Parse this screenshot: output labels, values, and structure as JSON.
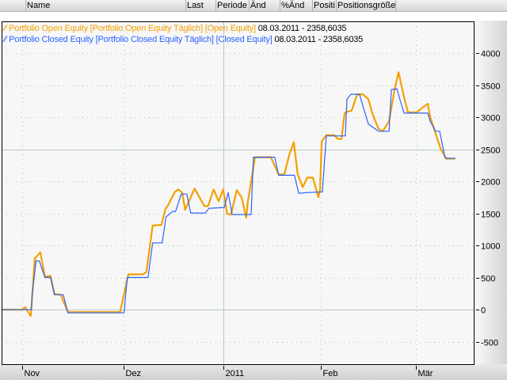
{
  "header": {
    "columns": [
      "Name",
      "Last",
      "Periode",
      "Änd",
      "%Änd",
      "Positi",
      "Positionsgröße"
    ]
  },
  "legend": [
    {
      "label": "Portfolio Open Equity [Portfolio Open Equity  Täglich] [Open Equity]",
      "value": "08.03.2011 - 2358,6035",
      "color": "#f5a000",
      "icon": "line-series-icon"
    },
    {
      "label": "Portfolio Closed Equity [Portfolio Closed Equity  Täglich] [Closed Equity]",
      "value": "08.03.2011 - 2358,6035",
      "color": "#2b63ff",
      "icon": "line-series-icon"
    }
  ],
  "chart_data": {
    "type": "line",
    "xlabel": "",
    "ylabel": "",
    "ylim": [
      -850,
      4500
    ],
    "xlim": [
      -6.2,
      137.6
    ],
    "x_unit": "days since 1 Nov 2010",
    "x_ticks": [
      {
        "label": "Nov",
        "x": 0
      },
      {
        "label": "Dez",
        "x": 31
      },
      {
        "label": "2011",
        "x": 61.3,
        "major": true
      },
      {
        "label": "Feb",
        "x": 91
      },
      {
        "label": "Mär",
        "x": 120
      }
    ],
    "y_ticks": [
      -500,
      0,
      500,
      1000,
      1500,
      2000,
      2500,
      3000,
      3500,
      4000
    ],
    "y_major": [
      0,
      2500
    ],
    "series": [
      {
        "name": "Portfolio Open Equity",
        "color": "#f5a000",
        "points": [
          [
            -6,
            0
          ],
          [
            0,
            0
          ],
          [
            1,
            37
          ],
          [
            1.9,
            -37
          ],
          [
            2.7,
            -98
          ],
          [
            3.9,
            798
          ],
          [
            5.6,
            896
          ],
          [
            7,
            515
          ],
          [
            8.7,
            528
          ],
          [
            9.9,
            245
          ],
          [
            11.8,
            233
          ],
          [
            13.5,
            25
          ],
          [
            14,
            -37
          ],
          [
            29.9,
            -37
          ],
          [
            32.4,
            552
          ],
          [
            36.9,
            552
          ],
          [
            37.9,
            590
          ],
          [
            39.8,
            1313
          ],
          [
            42.5,
            1325
          ],
          [
            43.7,
            1571
          ],
          [
            44.4,
            1620
          ],
          [
            46.6,
            1840
          ],
          [
            47.6,
            1877
          ],
          [
            48.8,
            1828
          ],
          [
            49.7,
            1558
          ],
          [
            52.6,
            1890
          ],
          [
            55.5,
            1620
          ],
          [
            56.7,
            1620
          ],
          [
            58.4,
            1877
          ],
          [
            59.9,
            1693
          ],
          [
            61.3,
            1877
          ],
          [
            62.5,
            1497
          ],
          [
            63.7,
            1485
          ],
          [
            65.4,
            1865
          ],
          [
            66.9,
            1755
          ],
          [
            68.3,
            1436
          ],
          [
            68.8,
            1681
          ],
          [
            71,
            2380
          ],
          [
            75.8,
            2380
          ],
          [
            78.2,
            2110
          ],
          [
            79.9,
            2110
          ],
          [
            81.4,
            2417
          ],
          [
            82.8,
            2614
          ],
          [
            84,
            2110
          ],
          [
            85.5,
            1914
          ],
          [
            86.9,
            2061
          ],
          [
            88.6,
            2061
          ],
          [
            89.8,
            1840
          ],
          [
            90.3,
            1755
          ],
          [
            90.8,
            1877
          ],
          [
            91.3,
            2626
          ],
          [
            92.7,
            2724
          ],
          [
            95.1,
            2724
          ],
          [
            96.3,
            2663
          ],
          [
            97.3,
            2663
          ],
          [
            98.3,
            3068
          ],
          [
            99,
            3092
          ],
          [
            100.4,
            3104
          ],
          [
            102.1,
            3362
          ],
          [
            103.8,
            3362
          ],
          [
            105.5,
            3288
          ],
          [
            106.7,
            3068
          ],
          [
            108.6,
            2822
          ],
          [
            109.9,
            2785
          ],
          [
            111.8,
            2945
          ],
          [
            113.5,
            3436
          ],
          [
            114.7,
            3706
          ],
          [
            116.6,
            3264
          ],
          [
            117.6,
            3080
          ],
          [
            120.2,
            3080
          ],
          [
            121.7,
            3141
          ],
          [
            123.6,
            3215
          ],
          [
            124.3,
            3018
          ],
          [
            126,
            2748
          ],
          [
            127.5,
            2515
          ],
          [
            129.2,
            2356
          ],
          [
            132,
            2358.6
          ]
        ]
      },
      {
        "name": "Portfolio Closed Equity",
        "color": "#2b63ff",
        "points": [
          [
            -6,
            0
          ],
          [
            2.9,
            0
          ],
          [
            3.1,
            221
          ],
          [
            4.3,
            761
          ],
          [
            5.3,
            761
          ],
          [
            7,
            503
          ],
          [
            8.7,
            503
          ],
          [
            9.9,
            233
          ],
          [
            12.6,
            233
          ],
          [
            14,
            -49
          ],
          [
            31.1,
            -49
          ],
          [
            32.1,
            503
          ],
          [
            38.4,
            503
          ],
          [
            39.8,
            1043
          ],
          [
            42.7,
            1043
          ],
          [
            43.9,
            1448
          ],
          [
            45.9,
            1534
          ],
          [
            46.8,
            1534
          ],
          [
            48.5,
            1804
          ],
          [
            50.2,
            1804
          ],
          [
            51.4,
            1509
          ],
          [
            55.8,
            1509
          ],
          [
            57,
            1583
          ],
          [
            61.6,
            1595
          ],
          [
            62.8,
            1828
          ],
          [
            64,
            1485
          ],
          [
            69.8,
            1485
          ],
          [
            70.5,
            2380
          ],
          [
            77,
            2380
          ],
          [
            78.2,
            2098
          ],
          [
            83,
            2098
          ],
          [
            84.3,
            1816
          ],
          [
            86.7,
            1828
          ],
          [
            91.5,
            1840
          ],
          [
            92.7,
            2712
          ],
          [
            98.5,
            2712
          ],
          [
            99,
            3288
          ],
          [
            100.2,
            3362
          ],
          [
            102.8,
            3362
          ],
          [
            103.8,
            3190
          ],
          [
            105.5,
            2896
          ],
          [
            108.6,
            2785
          ],
          [
            111.8,
            2785
          ],
          [
            112.5,
            3436
          ],
          [
            114.2,
            3448
          ],
          [
            115.2,
            3264
          ],
          [
            116.4,
            3068
          ],
          [
            123.6,
            3068
          ],
          [
            124.3,
            2945
          ],
          [
            126,
            2785
          ],
          [
            127.2,
            2785
          ],
          [
            128.9,
            2368
          ],
          [
            132,
            2358.6
          ]
        ]
      }
    ]
  }
}
